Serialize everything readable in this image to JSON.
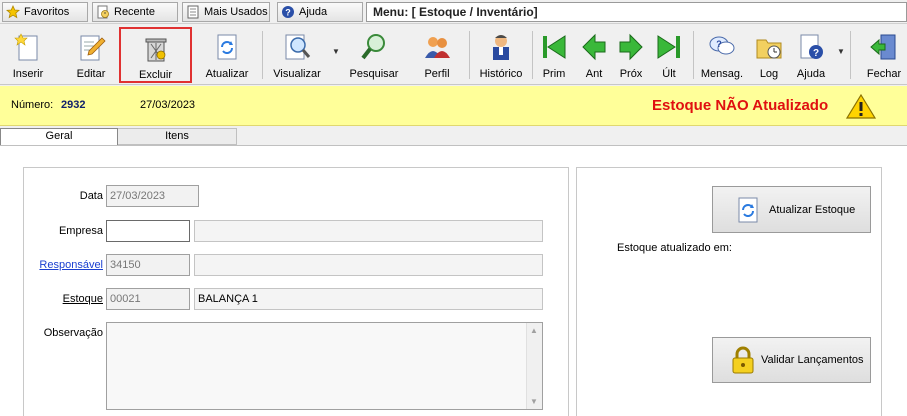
{
  "topbar": {
    "favoritos": "Favoritos",
    "recente": "Recente",
    "mais_usados": "Mais Usados",
    "ajuda": "Ajuda",
    "menu_path": "Menu: [ Estoque / Inventário]"
  },
  "toolbar": {
    "inserir": "Inserir",
    "editar": "Editar",
    "excluir": "Excluir",
    "atualizar": "Atualizar",
    "visualizar": "Visualizar",
    "pesquisar": "Pesquisar",
    "perfil": "Perfil",
    "historico": "Histórico",
    "prim": "Prim",
    "ant": "Ant",
    "prox": "Próx",
    "ult": "Últ",
    "mensag": "Mensag.",
    "log": "Log",
    "ajuda": "Ajuda",
    "fechar": "Fechar"
  },
  "status": {
    "numero_label": "Número:",
    "numero_value": "2932",
    "date": "27/03/2023",
    "alert": "Estoque NÃO Atualizado"
  },
  "tabs": {
    "geral": "Geral",
    "itens": "Itens"
  },
  "form": {
    "data_label": "Data",
    "data_value": "27/03/2023",
    "empresa_label": "Empresa",
    "empresa_code": "",
    "empresa_name": "",
    "responsavel_label": "Responsável",
    "responsavel_code": "34150",
    "responsavel_name": "",
    "estoque_label": "Estoque",
    "estoque_code": "00021",
    "estoque_name": "BALANÇA 1",
    "observacao_label": "Observação",
    "observacao_value": ""
  },
  "side": {
    "atualizar_estoque": "Atualizar Estoque",
    "estoque_atualizado_em": "Estoque atualizado em:",
    "validar_lancamentos": "Validar Lançamentos"
  },
  "colors": {
    "alert_text": "#e01010",
    "status_bg": "#ffff99",
    "selected_border": "#e03131",
    "link": "#1a3fd0"
  }
}
